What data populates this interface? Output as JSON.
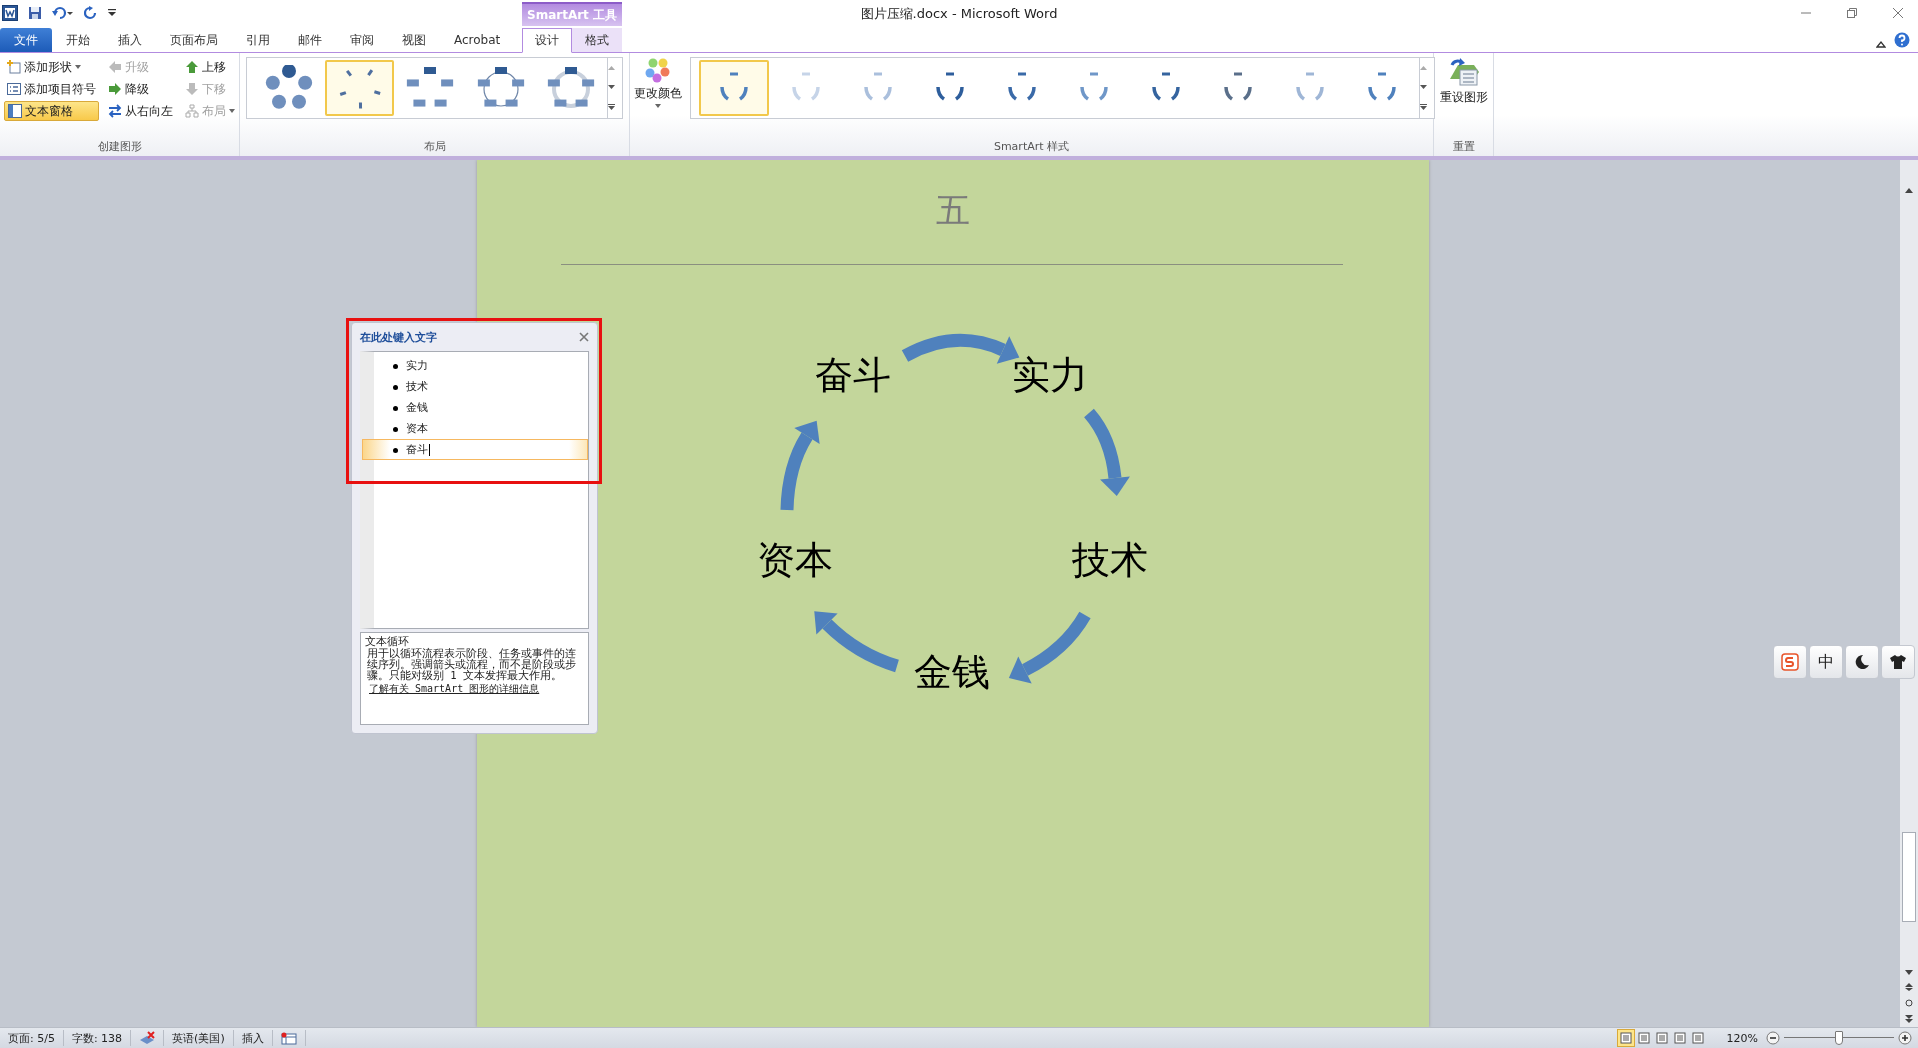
{
  "window": {
    "title": "图片压缩.docx - Microsoft Word"
  },
  "contextual_tab": {
    "label": "SmartArt 工具"
  },
  "tabs": [
    {
      "label": "文件",
      "kind": "file",
      "selected": false
    },
    {
      "label": "开始",
      "kind": "tab",
      "selected": false
    },
    {
      "label": "插入",
      "kind": "tab",
      "selected": false
    },
    {
      "label": "页面布局",
      "kind": "tab",
      "selected": false
    },
    {
      "label": "引用",
      "kind": "tab",
      "selected": false
    },
    {
      "label": "邮件",
      "kind": "tab",
      "selected": false
    },
    {
      "label": "审阅",
      "kind": "tab",
      "selected": false
    },
    {
      "label": "视图",
      "kind": "tab",
      "selected": false
    },
    {
      "label": "Acrobat",
      "kind": "tab",
      "selected": false
    },
    {
      "label": "设计",
      "kind": "context",
      "selected": true
    },
    {
      "label": "格式",
      "kind": "context",
      "selected": false
    }
  ],
  "ribbon": {
    "create_group": {
      "label": "创建图形",
      "buttons": [
        {
          "label": "添加形状",
          "kind": "add-shape",
          "disabled": false,
          "selected": false,
          "dropdown": true
        },
        {
          "label": "添加项目符号",
          "kind": "add-bullet",
          "disabled": false,
          "selected": false,
          "dropdown": false
        },
        {
          "label": "文本窗格",
          "kind": "text-pane",
          "disabled": false,
          "selected": true,
          "dropdown": false
        },
        {
          "label": "升级",
          "kind": "promote",
          "disabled": true,
          "selected": false,
          "dropdown": false
        },
        {
          "label": "降级",
          "kind": "demote",
          "disabled": false,
          "selected": false,
          "dropdown": false
        },
        {
          "label": "从右向左",
          "kind": "rtl",
          "disabled": false,
          "selected": false,
          "dropdown": false
        },
        {
          "label": "上移",
          "kind": "move-up",
          "disabled": false,
          "selected": false,
          "dropdown": false
        },
        {
          "label": "下移",
          "kind": "move-down",
          "disabled": true,
          "selected": false,
          "dropdown": false
        },
        {
          "label": "布局",
          "kind": "layout",
          "disabled": true,
          "selected": false,
          "dropdown": true
        }
      ]
    },
    "layout_group": {
      "label": "布局",
      "layouts": [
        {
          "selected": false
        },
        {
          "selected": true
        },
        {
          "selected": false
        },
        {
          "selected": false
        },
        {
          "selected": false
        }
      ]
    },
    "style_group": {
      "label": "SmartArt 样式",
      "change_color": "更改颜色",
      "styles": [
        {
          "selected": true
        },
        {
          "selected": false
        },
        {
          "selected": false
        },
        {
          "selected": false
        },
        {
          "selected": false
        },
        {
          "selected": false
        },
        {
          "selected": false
        },
        {
          "selected": false
        },
        {
          "selected": false
        },
        {
          "selected": false
        }
      ]
    },
    "reset_group": {
      "label": "重置",
      "button": "重设图形"
    }
  },
  "document": {
    "heading": "五",
    "smartart": {
      "nodes": [
        {
          "label": "实力"
        },
        {
          "label": "技术"
        },
        {
          "label": "金钱"
        },
        {
          "label": "资本"
        },
        {
          "label": "奋斗"
        }
      ]
    }
  },
  "text_pane": {
    "title": "在此处键入文字",
    "items": [
      {
        "text": "实力",
        "selected": false
      },
      {
        "text": "技术",
        "selected": false
      },
      {
        "text": "金钱",
        "selected": false
      },
      {
        "text": "资本",
        "selected": false
      },
      {
        "text": "奋斗",
        "selected": true
      }
    ],
    "layout_name": "文本循环",
    "description": "用于以循环流程表示阶段、任务或事件的连续序列。强调箭头或流程，而不是阶段或步骤。只能对级别 1 文本发挥最大作用。",
    "link": "了解有关 SmartArt 图形的详细信息"
  },
  "ime": {
    "mode": "中"
  },
  "status_bar": {
    "page": "页面: 5/5",
    "word_count": "字数: 138",
    "language": "英语(美国)",
    "mode": "插入",
    "views": [
      {
        "selected": true
      },
      {
        "selected": false
      },
      {
        "selected": false
      },
      {
        "selected": false
      },
      {
        "selected": false
      }
    ],
    "zoom": "120%",
    "zoom_slider": {
      "level": 0.5
    }
  }
}
